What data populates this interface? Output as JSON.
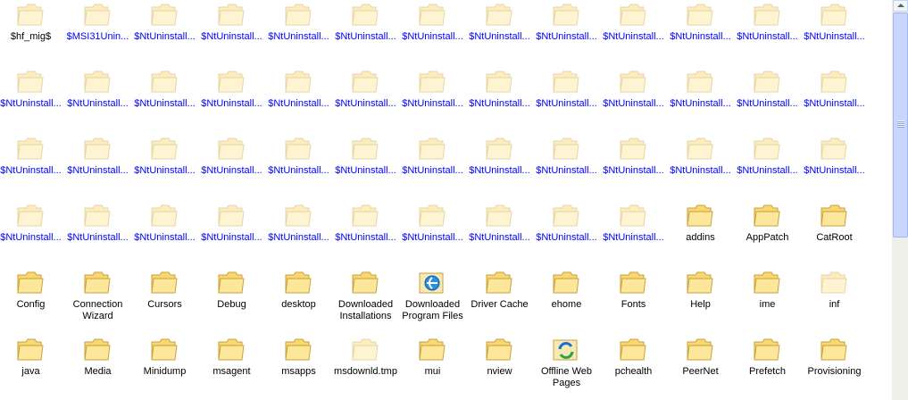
{
  "folder_view": {
    "items": [
      {
        "label": "$hf_mig$",
        "kind": "folder",
        "hidden": true,
        "compressed": false
      },
      {
        "label": "$MSI31Unin...",
        "kind": "folder",
        "hidden": true,
        "compressed": true
      },
      {
        "label": "$NtUninstall...",
        "kind": "folder",
        "hidden": true,
        "compressed": true
      },
      {
        "label": "$NtUninstall...",
        "kind": "folder",
        "hidden": true,
        "compressed": true
      },
      {
        "label": "$NtUninstall...",
        "kind": "folder",
        "hidden": true,
        "compressed": true
      },
      {
        "label": "$NtUninstall...",
        "kind": "folder",
        "hidden": true,
        "compressed": true
      },
      {
        "label": "$NtUninstall...",
        "kind": "folder",
        "hidden": true,
        "compressed": true
      },
      {
        "label": "$NtUninstall...",
        "kind": "folder",
        "hidden": true,
        "compressed": true
      },
      {
        "label": "$NtUninstall...",
        "kind": "folder",
        "hidden": true,
        "compressed": true
      },
      {
        "label": "$NtUninstall...",
        "kind": "folder",
        "hidden": true,
        "compressed": true
      },
      {
        "label": "$NtUninstall...",
        "kind": "folder",
        "hidden": true,
        "compressed": true
      },
      {
        "label": "$NtUninstall...",
        "kind": "folder",
        "hidden": true,
        "compressed": true
      },
      {
        "label": "$NtUninstall...",
        "kind": "folder",
        "hidden": true,
        "compressed": true
      },
      {
        "label": "$NtUninstall...",
        "kind": "folder",
        "hidden": true,
        "compressed": true
      },
      {
        "label": "$NtUninstall...",
        "kind": "folder",
        "hidden": true,
        "compressed": true
      },
      {
        "label": "$NtUninstall...",
        "kind": "folder",
        "hidden": true,
        "compressed": true
      },
      {
        "label": "$NtUninstall...",
        "kind": "folder",
        "hidden": true,
        "compressed": true
      },
      {
        "label": "$NtUninstall...",
        "kind": "folder",
        "hidden": true,
        "compressed": true
      },
      {
        "label": "$NtUninstall...",
        "kind": "folder",
        "hidden": true,
        "compressed": true
      },
      {
        "label": "$NtUninstall...",
        "kind": "folder",
        "hidden": true,
        "compressed": true
      },
      {
        "label": "$NtUninstall...",
        "kind": "folder",
        "hidden": true,
        "compressed": true
      },
      {
        "label": "$NtUninstall...",
        "kind": "folder",
        "hidden": true,
        "compressed": true
      },
      {
        "label": "$NtUninstall...",
        "kind": "folder",
        "hidden": true,
        "compressed": true
      },
      {
        "label": "$NtUninstall...",
        "kind": "folder",
        "hidden": true,
        "compressed": true
      },
      {
        "label": "$NtUninstall...",
        "kind": "folder",
        "hidden": true,
        "compressed": true
      },
      {
        "label": "$NtUninstall...",
        "kind": "folder",
        "hidden": true,
        "compressed": true
      },
      {
        "label": "$NtUninstall...",
        "kind": "folder",
        "hidden": true,
        "compressed": true
      },
      {
        "label": "$NtUninstall...",
        "kind": "folder",
        "hidden": true,
        "compressed": true
      },
      {
        "label": "$NtUninstall...",
        "kind": "folder",
        "hidden": true,
        "compressed": true
      },
      {
        "label": "$NtUninstall...",
        "kind": "folder",
        "hidden": true,
        "compressed": true
      },
      {
        "label": "$NtUninstall...",
        "kind": "folder",
        "hidden": true,
        "compressed": true
      },
      {
        "label": "$NtUninstall...",
        "kind": "folder",
        "hidden": true,
        "compressed": true
      },
      {
        "label": "$NtUninstall...",
        "kind": "folder",
        "hidden": true,
        "compressed": true
      },
      {
        "label": "$NtUninstall...",
        "kind": "folder",
        "hidden": true,
        "compressed": true
      },
      {
        "label": "$NtUninstall...",
        "kind": "folder",
        "hidden": true,
        "compressed": true
      },
      {
        "label": "$NtUninstall...",
        "kind": "folder",
        "hidden": true,
        "compressed": true
      },
      {
        "label": "$NtUninstall...",
        "kind": "folder",
        "hidden": true,
        "compressed": true
      },
      {
        "label": "$NtUninstall...",
        "kind": "folder",
        "hidden": true,
        "compressed": true
      },
      {
        "label": "$NtUninstall...",
        "kind": "folder",
        "hidden": true,
        "compressed": true
      },
      {
        "label": "$NtUninstall...",
        "kind": "folder",
        "hidden": true,
        "compressed": true
      },
      {
        "label": "$NtUninstall...",
        "kind": "folder",
        "hidden": true,
        "compressed": true
      },
      {
        "label": "$NtUninstall...",
        "kind": "folder",
        "hidden": true,
        "compressed": true
      },
      {
        "label": "$NtUninstall...",
        "kind": "folder",
        "hidden": true,
        "compressed": true
      },
      {
        "label": "$NtUninstall...",
        "kind": "folder",
        "hidden": true,
        "compressed": true
      },
      {
        "label": "$NtUninstall...",
        "kind": "folder",
        "hidden": true,
        "compressed": true
      },
      {
        "label": "$NtUninstall...",
        "kind": "folder",
        "hidden": true,
        "compressed": true
      },
      {
        "label": "$NtUninstall...",
        "kind": "folder",
        "hidden": true,
        "compressed": true
      },
      {
        "label": "$NtUninstall...",
        "kind": "folder",
        "hidden": true,
        "compressed": true
      },
      {
        "label": "$NtUninstall...",
        "kind": "folder",
        "hidden": true,
        "compressed": true
      },
      {
        "label": "addins",
        "kind": "folder",
        "hidden": false,
        "compressed": false
      },
      {
        "label": "AppPatch",
        "kind": "folder",
        "hidden": false,
        "compressed": false
      },
      {
        "label": "CatRoot",
        "kind": "folder",
        "hidden": false,
        "compressed": false
      },
      {
        "label": "Config",
        "kind": "folder",
        "hidden": false,
        "compressed": false
      },
      {
        "label": "Connection\nWizard",
        "kind": "folder",
        "hidden": false,
        "compressed": false
      },
      {
        "label": "Cursors",
        "kind": "folder",
        "hidden": false,
        "compressed": false
      },
      {
        "label": "Debug",
        "kind": "folder",
        "hidden": false,
        "compressed": false
      },
      {
        "label": "desktop",
        "kind": "folder",
        "hidden": false,
        "compressed": false
      },
      {
        "label": "Downloaded\nInstallations",
        "kind": "folder",
        "hidden": false,
        "compressed": false
      },
      {
        "label": "Downloaded\nProgram Files",
        "kind": "ie-folder",
        "hidden": false,
        "compressed": false
      },
      {
        "label": "Driver Cache",
        "kind": "folder",
        "hidden": false,
        "compressed": false
      },
      {
        "label": "ehome",
        "kind": "folder",
        "hidden": false,
        "compressed": false
      },
      {
        "label": "Fonts",
        "kind": "folder",
        "hidden": false,
        "compressed": false
      },
      {
        "label": "Help",
        "kind": "folder",
        "hidden": false,
        "compressed": false
      },
      {
        "label": "ime",
        "kind": "folder",
        "hidden": false,
        "compressed": false
      },
      {
        "label": "inf",
        "kind": "folder",
        "hidden": true,
        "compressed": false
      },
      {
        "label": "java",
        "kind": "folder",
        "hidden": false,
        "compressed": false
      },
      {
        "label": "Media",
        "kind": "folder",
        "hidden": false,
        "compressed": false
      },
      {
        "label": "Minidump",
        "kind": "folder",
        "hidden": false,
        "compressed": false
      },
      {
        "label": "msagent",
        "kind": "folder",
        "hidden": false,
        "compressed": false
      },
      {
        "label": "msapps",
        "kind": "folder",
        "hidden": false,
        "compressed": false
      },
      {
        "label": "msdownld.tmp",
        "kind": "folder",
        "hidden": true,
        "compressed": false
      },
      {
        "label": "mui",
        "kind": "folder",
        "hidden": false,
        "compressed": false
      },
      {
        "label": "nview",
        "kind": "folder",
        "hidden": false,
        "compressed": false
      },
      {
        "label": "Offline Web\nPages",
        "kind": "sync-folder",
        "hidden": false,
        "compressed": false
      },
      {
        "label": "pchealth",
        "kind": "folder",
        "hidden": false,
        "compressed": false
      },
      {
        "label": "PeerNet",
        "kind": "folder",
        "hidden": false,
        "compressed": false
      },
      {
        "label": "Prefetch",
        "kind": "folder",
        "hidden": false,
        "compressed": false
      },
      {
        "label": "Provisioning",
        "kind": "folder",
        "hidden": false,
        "compressed": false
      }
    ]
  },
  "colors": {
    "compressed_label": "#0000ff",
    "folder_fill": "#f9d771",
    "folder_edge": "#c9a13c"
  }
}
